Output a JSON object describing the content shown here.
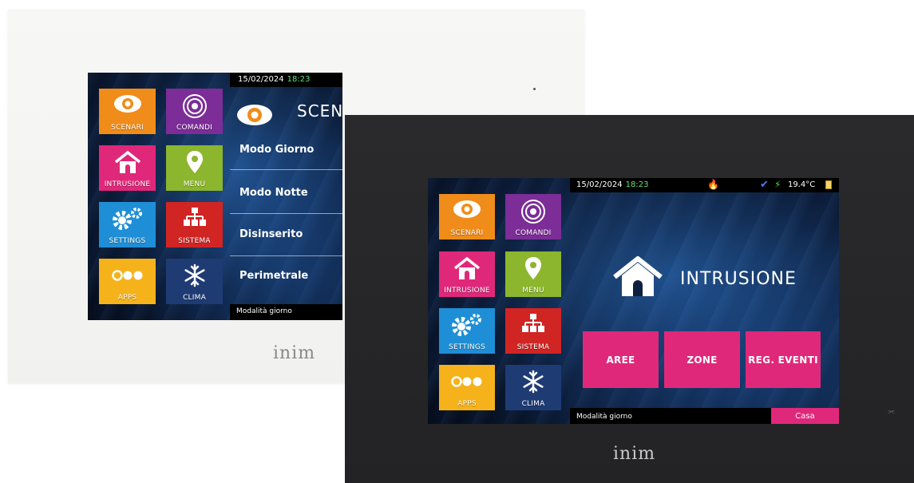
{
  "brand": "inim",
  "status": {
    "date": "15/02/2024",
    "time": "18:23",
    "temperature": "19.4°C"
  },
  "tiles": {
    "scenari": "SCENARI",
    "comandi": "COMANDI",
    "intrusione": "INTRUSIONE",
    "menu": "MENU",
    "settings": "SETTINGS",
    "sistema": "SISTEMA",
    "apps": "APPS",
    "clima": "CLIMA"
  },
  "white_screen": {
    "header": "SCENARI",
    "items": [
      "Modo Giorno",
      "Modo Notte",
      "Disinserito",
      "Perimetrale"
    ],
    "footer": "Modalità giorno"
  },
  "black_screen": {
    "header": "INTRUSIONE",
    "buttons": [
      "AREE",
      "ZONE",
      "REG. EVENTI"
    ],
    "footer": "Modalità giorno",
    "casa": "Casa"
  },
  "colors": {
    "orange": "#f08c1a",
    "purple": "#7c2d97",
    "pink": "#e0287a",
    "green": "#8cb62d",
    "blue": "#1e8fd6",
    "red": "#d12524",
    "yellow": "#f5b21b",
    "navy": "#1e3b74"
  },
  "icons": [
    "eye-icon",
    "touch-icon",
    "house-icon",
    "map-pin-icon",
    "gear-icon",
    "network-icon",
    "apps-dots-icon",
    "snowflake-icon",
    "flame-icon",
    "check-icon",
    "bolt-icon",
    "battery-icon",
    "wifi-icon"
  ]
}
